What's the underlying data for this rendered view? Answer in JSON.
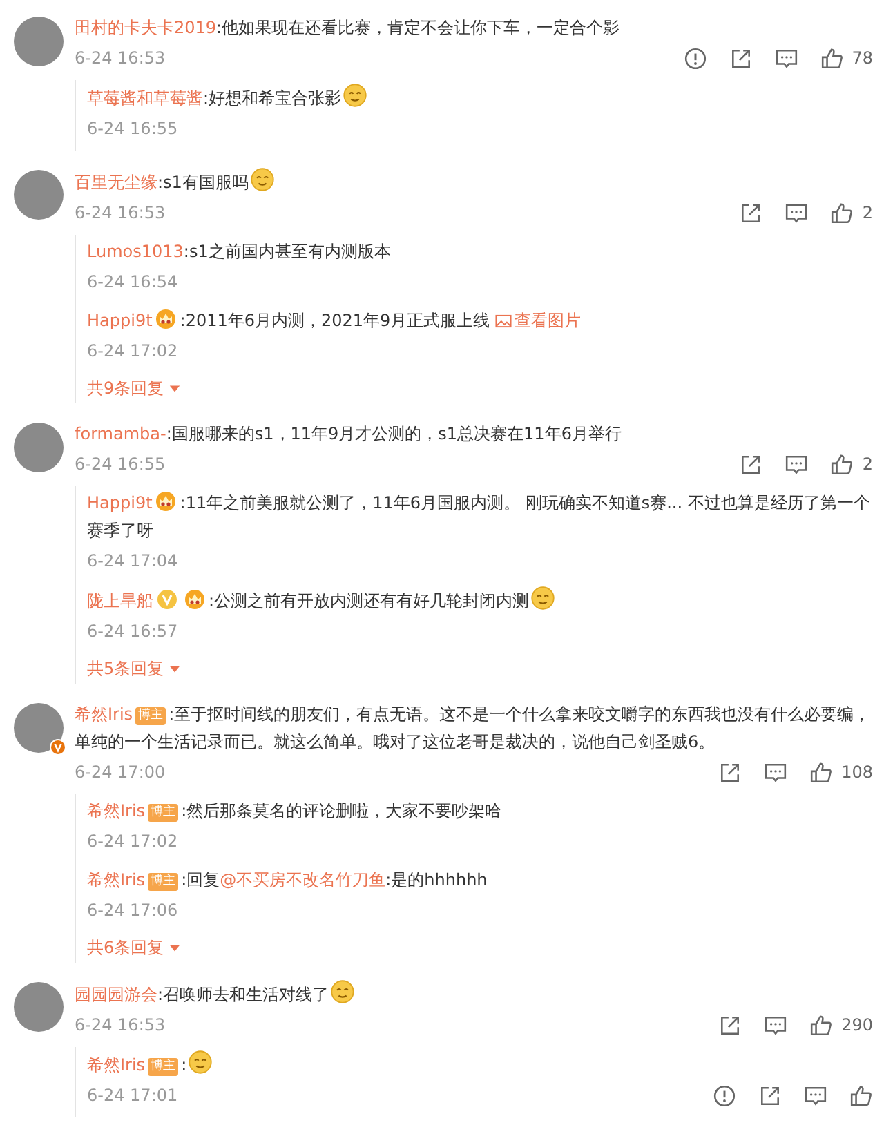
{
  "comments": [
    {
      "name": "田村的卡夫卡2019",
      "avatar_verified": false,
      "segments": [
        {
          "kind": "text",
          "text": ":他如果现在还看比赛，肯定不会让你下车，一定合个影"
        }
      ],
      "time": "6-24 16:53",
      "show_report": true,
      "likes": "78",
      "replies": [
        {
          "name": "草莓酱和草莓酱",
          "segments": [
            {
              "kind": "text",
              "text": ":好想和希宝合张影"
            },
            {
              "kind": "emoji"
            }
          ],
          "time": "6-24 16:55",
          "has_actions": false
        }
      ]
    },
    {
      "name": "百里无尘缘",
      "avatar_verified": false,
      "segments": [
        {
          "kind": "text",
          "text": ":s1有国服吗"
        },
        {
          "kind": "emoji"
        }
      ],
      "time": "6-24 16:53",
      "show_report": false,
      "likes": "2",
      "replies": [
        {
          "name": "Lumos1013",
          "segments": [
            {
              "kind": "text",
              "text": ":s1之前国内甚至有内测版本"
            }
          ],
          "time": "6-24 16:54",
          "has_actions": false
        },
        {
          "name": "Happi9t",
          "badges": [
            {
              "kind": "medal"
            }
          ],
          "segments": [
            {
              "kind": "text",
              "text": ":2011年6月内测，2021年9月正式服上线"
            },
            {
              "kind": "image-link",
              "text": "查看图片"
            }
          ],
          "time": "6-24 17:02",
          "has_actions": false
        }
      ],
      "more": "共9条回复"
    },
    {
      "name": "formamba-",
      "avatar_verified": false,
      "segments": [
        {
          "kind": "text",
          "text": ":国服哪来的s1，11年9月才公测的，s1总决赛在11年6月举行"
        }
      ],
      "time": "6-24 16:55",
      "show_report": false,
      "likes": "2",
      "replies": [
        {
          "name": "Happi9t",
          "badges": [
            {
              "kind": "medal"
            }
          ],
          "segments": [
            {
              "kind": "text",
              "text": ":11年之前美服就公测了，11年6月国服内测。 刚玩确实不知道s赛... 不过也算是经历了第一个赛季了呀"
            }
          ],
          "time": "6-24 17:04",
          "has_actions": false
        },
        {
          "name": "陇上旱船",
          "badges": [
            {
              "kind": "verified"
            },
            {
              "kind": "medal"
            }
          ],
          "segments": [
            {
              "kind": "text",
              "text": ":公测之前有开放内测还有有好几轮封闭内测"
            },
            {
              "kind": "emoji"
            }
          ],
          "time": "6-24 16:57",
          "has_actions": false
        }
      ],
      "more": "共5条回复"
    },
    {
      "name": "希然Iris",
      "avatar_verified": true,
      "badges": [
        {
          "kind": "label",
          "text": "博主"
        }
      ],
      "segments": [
        {
          "kind": "text",
          "text": ":至于抠时间线的朋友们，有点无语。这不是一个什么拿来咬文嚼字的东西我也没有什么必要编，单纯的一个生活记录而已。就这么简单。哦对了这位老哥是裁决的，说他自己剑圣贼6。"
        }
      ],
      "time": "6-24 17:00",
      "show_report": false,
      "likes": "108",
      "replies": [
        {
          "name": "希然Iris",
          "badges": [
            {
              "kind": "label",
              "text": "博主"
            }
          ],
          "segments": [
            {
              "kind": "text",
              "text": ":然后那条莫名的评论删啦，大家不要吵架哈"
            }
          ],
          "time": "6-24 17:02",
          "has_actions": false
        },
        {
          "name": "希然Iris",
          "badges": [
            {
              "kind": "label",
              "text": "博主"
            }
          ],
          "segments": [
            {
              "kind": "text",
              "text": ":回复"
            },
            {
              "kind": "mention",
              "text": "@不买房不改名竹刀鱼"
            },
            {
              "kind": "text",
              "text": ":是的hhhhhh"
            }
          ],
          "time": "6-24 17:06",
          "has_actions": false
        }
      ],
      "more": "共6条回复"
    },
    {
      "name": "园园园游会",
      "avatar_verified": false,
      "segments": [
        {
          "kind": "text",
          "text": ":召唤师去和生活对线了"
        },
        {
          "kind": "emoji"
        }
      ],
      "time": "6-24 16:53",
      "show_report": false,
      "likes": "290",
      "replies": [
        {
          "name": "希然Iris",
          "badges": [
            {
              "kind": "label",
              "text": "博主"
            }
          ],
          "segments": [
            {
              "kind": "text",
              "text": ":"
            },
            {
              "kind": "emoji"
            }
          ],
          "time": "6-24 17:01",
          "has_actions": true
        }
      ]
    }
  ]
}
